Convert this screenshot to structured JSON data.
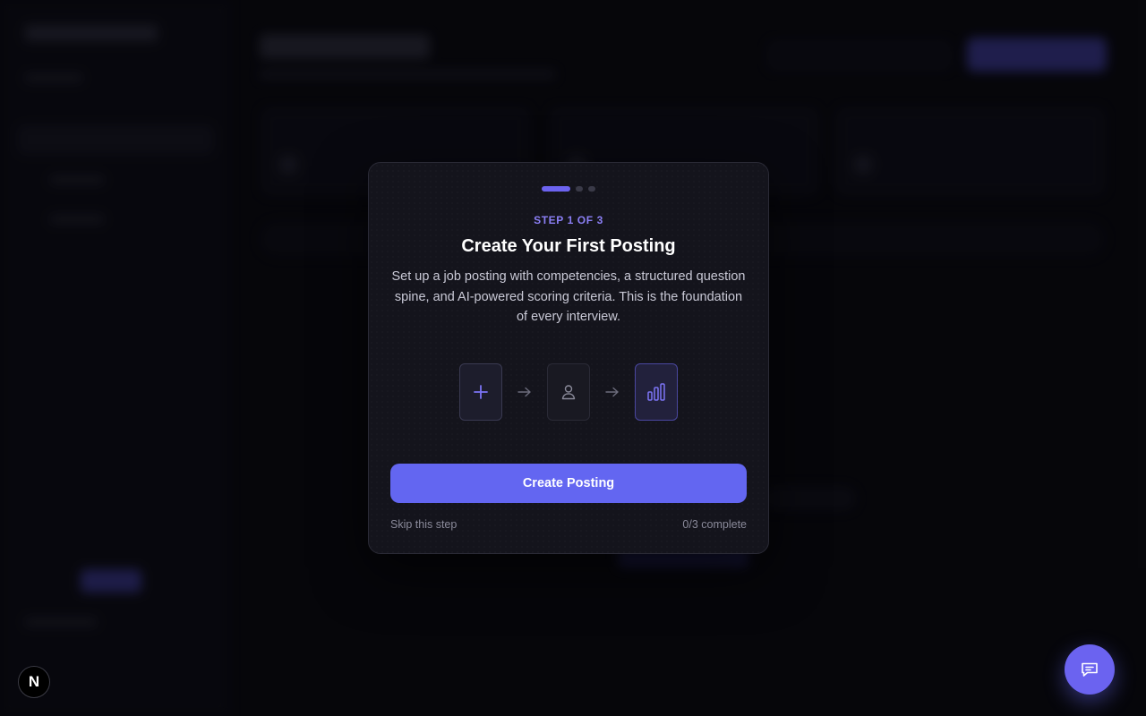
{
  "modal": {
    "progress_steps": 3,
    "active_step": 1,
    "step_label": "STEP 1 OF 3",
    "title": "Create Your First Posting",
    "description": "Set up a job posting with competencies, a structured question spine, and AI-powered scoring criteria. This is the foundation of every interview.",
    "flow_icons": [
      "plus-icon",
      "arrow-right-icon",
      "user-icon",
      "arrow-right-icon",
      "bar-chart-icon"
    ],
    "cta_label": "Create Posting",
    "skip_label": "Skip this step",
    "completion": "0/3 complete"
  },
  "corner": {
    "badge_letter": "N",
    "chat_icon": "chat-icon"
  },
  "colors": {
    "accent": "#6366f1",
    "step_label": "#8b7ff5",
    "modal_bg": "#14141c",
    "page_bg": "#08080c"
  }
}
